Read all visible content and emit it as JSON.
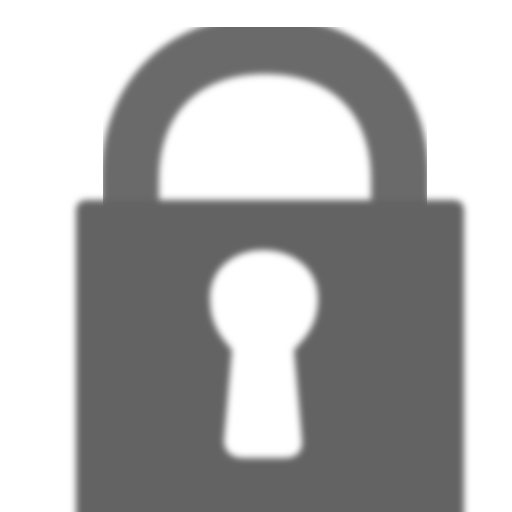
{
  "icon": {
    "name": "lock-icon",
    "state": "locked",
    "colors": {
      "background": "#ffffff",
      "body": "#636363",
      "shackle": "#6b6b6b",
      "keyhole": "#ffffff"
    }
  }
}
